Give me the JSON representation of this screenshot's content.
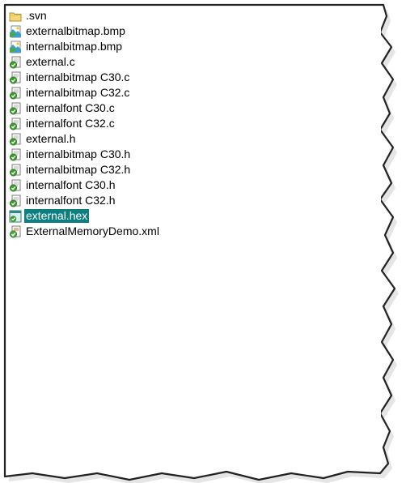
{
  "files": [
    {
      "name": ".svn",
      "icon": "folder-icon",
      "selected": false
    },
    {
      "name": "externalbitmap.bmp",
      "icon": "bitmap-file-icon",
      "selected": false
    },
    {
      "name": "internalbitmap.bmp",
      "icon": "bitmap-file-icon",
      "selected": false
    },
    {
      "name": "external.c",
      "icon": "source-file-icon",
      "selected": false
    },
    {
      "name": "internalbitmap C30.c",
      "icon": "source-file-icon",
      "selected": false
    },
    {
      "name": "internalbitmap C32.c",
      "icon": "source-file-icon",
      "selected": false
    },
    {
      "name": "internalfont C30.c",
      "icon": "source-file-icon",
      "selected": false
    },
    {
      "name": "internalfont C32.c",
      "icon": "source-file-icon",
      "selected": false
    },
    {
      "name": "external.h",
      "icon": "source-file-icon",
      "selected": false
    },
    {
      "name": "internalbitmap C30.h",
      "icon": "source-file-icon",
      "selected": false
    },
    {
      "name": "internalbitmap C32.h",
      "icon": "source-file-icon",
      "selected": false
    },
    {
      "name": "internalfont C30.h",
      "icon": "source-file-icon",
      "selected": false
    },
    {
      "name": "internalfont C32.h",
      "icon": "source-file-icon",
      "selected": false
    },
    {
      "name": "external.hex",
      "icon": "hex-file-icon",
      "selected": true
    },
    {
      "name": "ExternalMemoryDemo.xml",
      "icon": "xml-file-icon",
      "selected": false
    }
  ],
  "colors": {
    "selection": "#0e7f80",
    "folder": "#f4d77a",
    "file_check": "#3a9a2a"
  }
}
